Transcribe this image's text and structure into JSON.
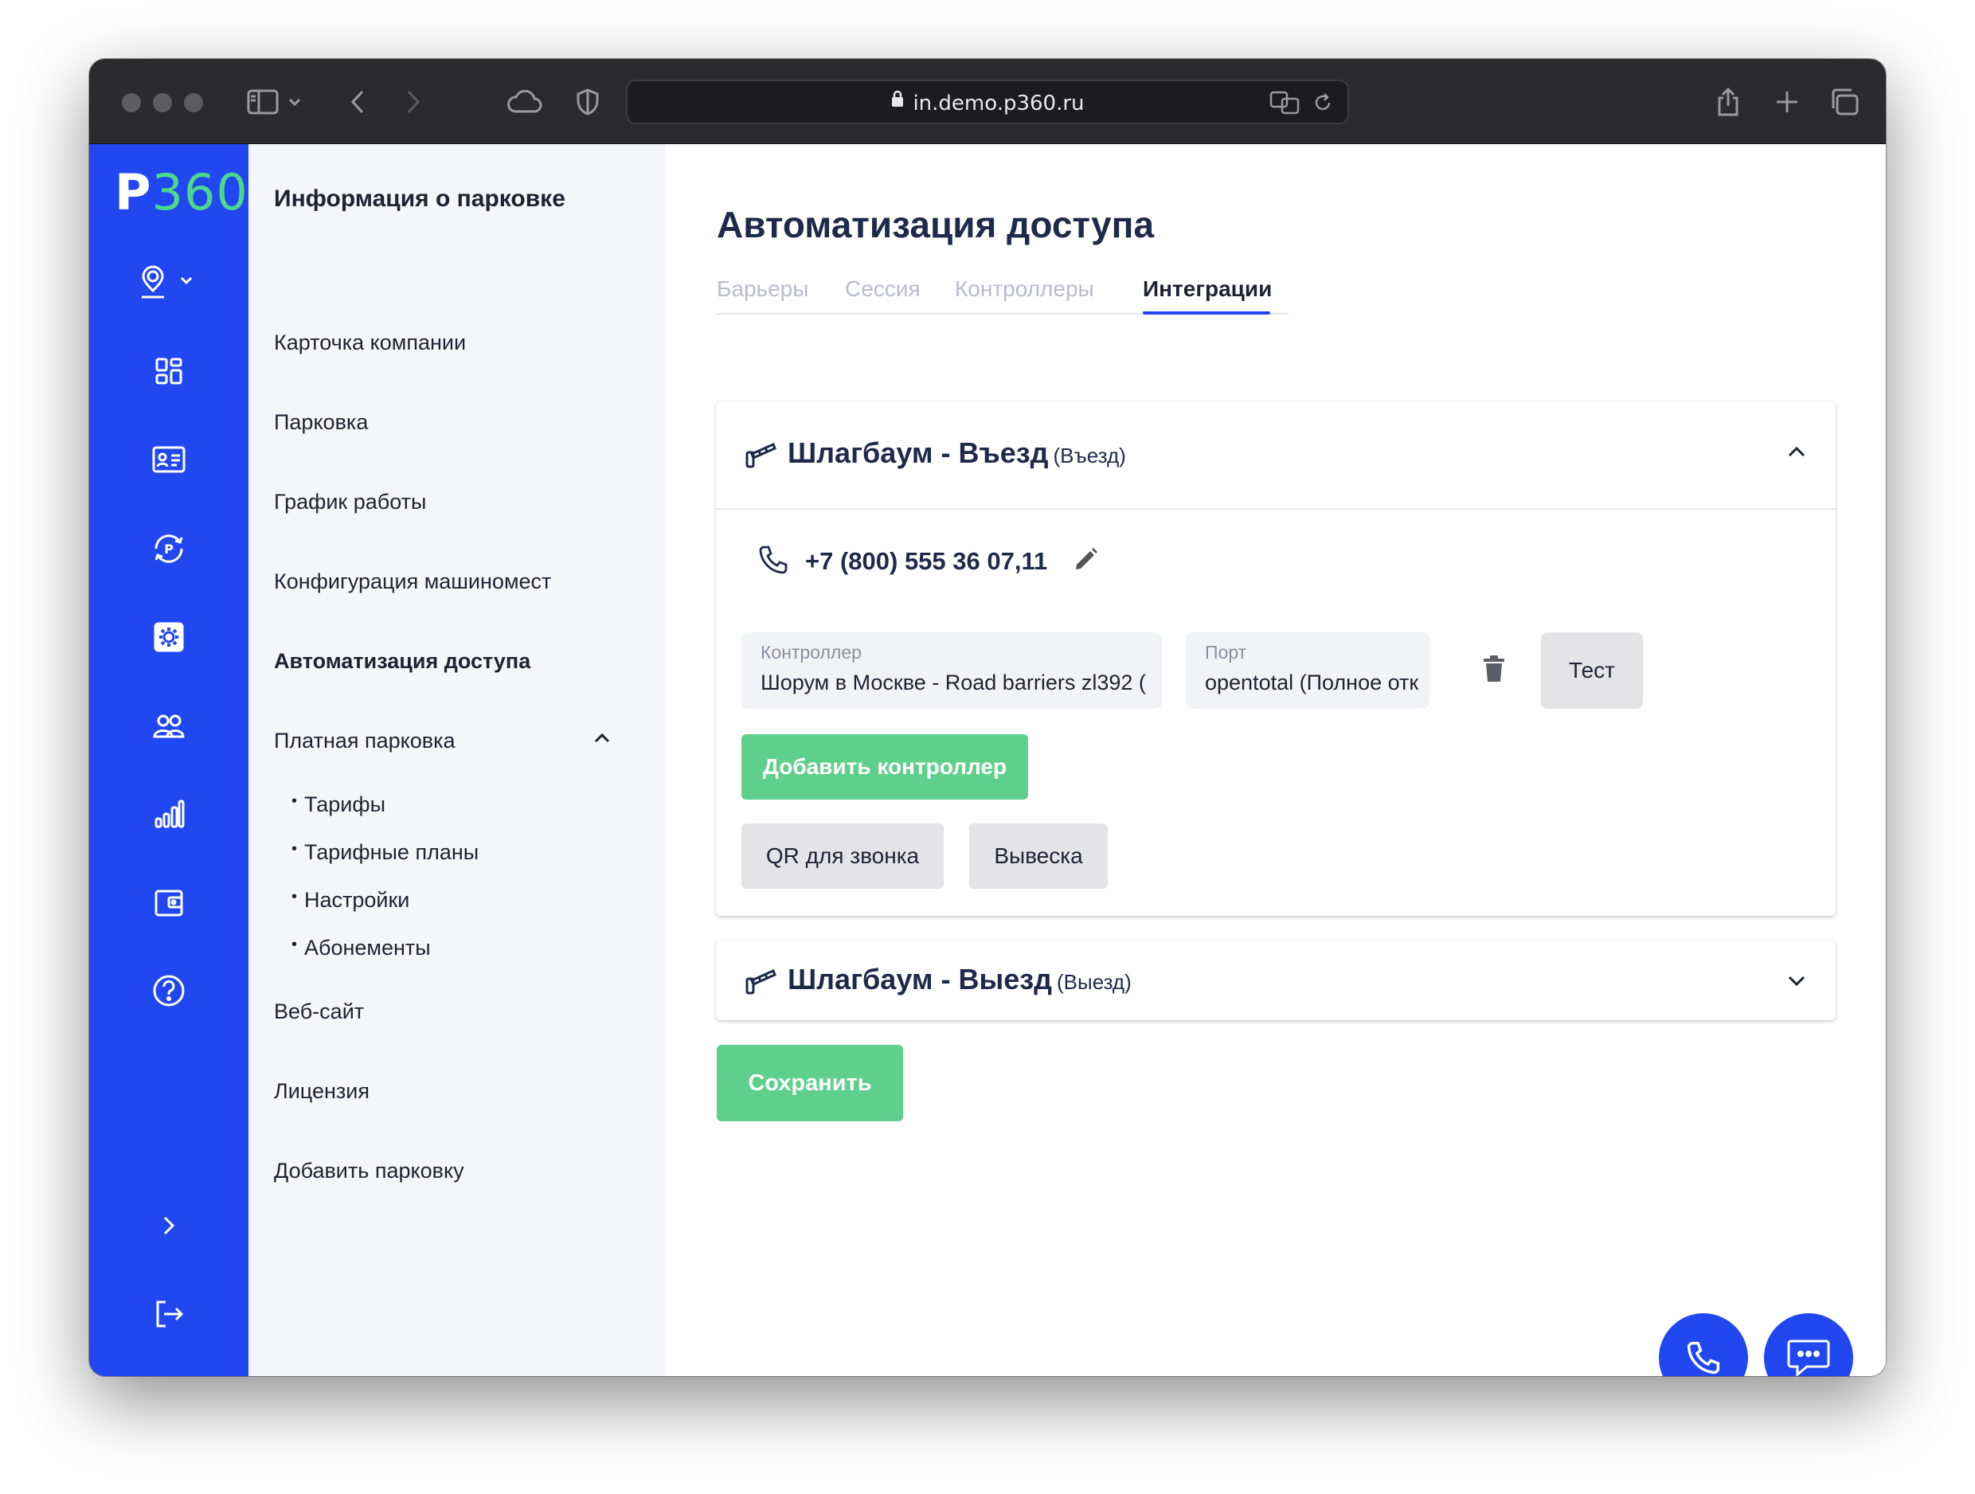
{
  "browser": {
    "url": "in.demo.p360.ru"
  },
  "logo": {
    "p": "P",
    "num": "360"
  },
  "submenu": {
    "title": "Информация о парковке",
    "items": {
      "company_card": "Карточка компании",
      "parking": "Парковка",
      "schedule": "График работы",
      "spaces_config": "Конфигурация машиномест",
      "access_automation": "Автоматизация доступа",
      "paid_parking": "Платная парковка",
      "website": "Веб-сайт",
      "license": "Лицензия",
      "add_parking": "Добавить парковку"
    },
    "paid_sub": {
      "tariffs": "Тарифы",
      "tariff_plans": "Тарифные планы",
      "settings": "Настройки",
      "subscriptions": "Абонементы"
    }
  },
  "main": {
    "title": "Автоматизация доступа",
    "tabs": {
      "barriers": "Барьеры",
      "session": "Сессия",
      "controllers": "Контроллеры",
      "integrations": "Интеграции"
    },
    "entry_card": {
      "title": "Шлагбаум - Въезд",
      "subtitle": "(Въезд)",
      "phone": "+7 (800) 555 36 07,11",
      "controller_label": "Контроллер",
      "controller_value": "Шорум в Москве - Road barriers zl392 (",
      "port_label": "Порт",
      "port_value": "opentotal (Полное отк",
      "test_button": "Тест",
      "add_controller_button": "Добавить контроллер",
      "qr_button": "QR для звонка",
      "sign_button": "Вывеска"
    },
    "exit_card": {
      "title": "Шлагбаум - Выезд",
      "subtitle": "(Выезд)"
    },
    "save_button": "Сохранить"
  },
  "colors": {
    "brand_blue": "#2148f0",
    "green": "#5fd08c",
    "logo_green": "#4cd98a"
  }
}
